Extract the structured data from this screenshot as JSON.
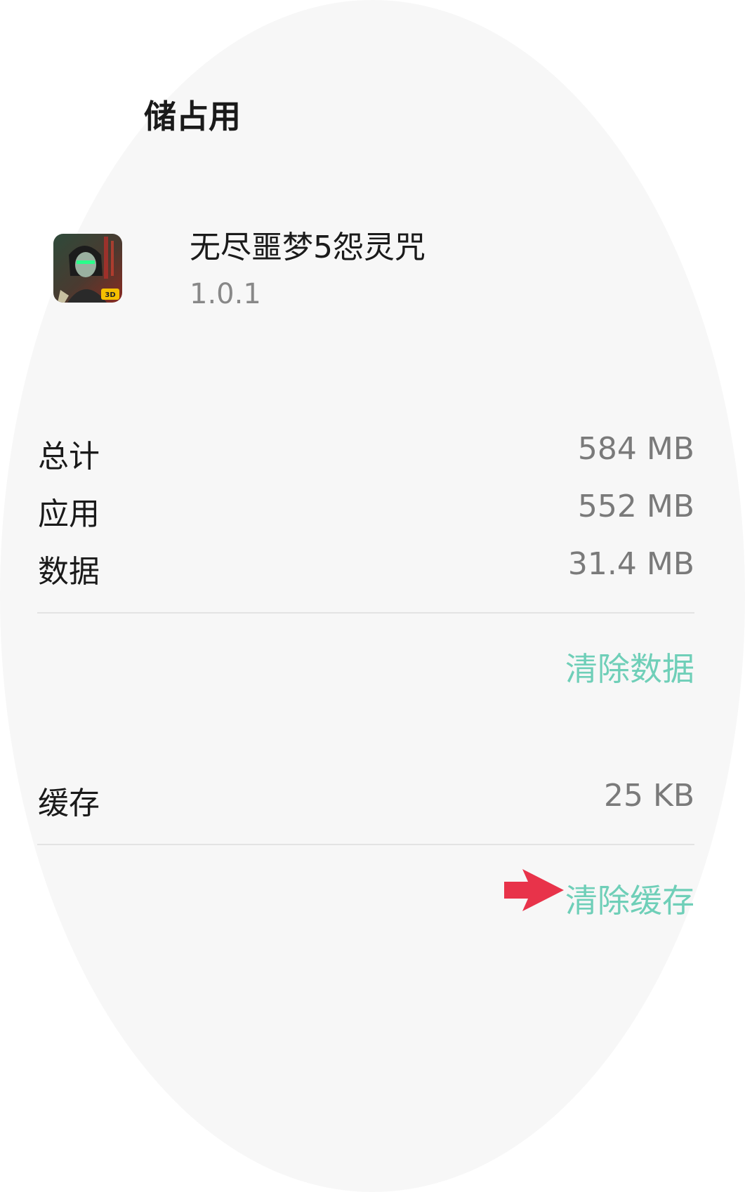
{
  "header": {
    "title": "储占用"
  },
  "app": {
    "name": "无尽噩梦5怨灵咒",
    "version": "1.0.1",
    "icon": "game-character-icon",
    "icon_badge": "3D"
  },
  "storage": {
    "rows": [
      {
        "label": "总计",
        "value": "584 MB"
      },
      {
        "label": "应用",
        "value": "552 MB"
      },
      {
        "label": "数据",
        "value": "31.4 MB"
      }
    ],
    "clear_data_label": "清除数据"
  },
  "cache": {
    "label": "缓存",
    "value": "25 KB",
    "clear_cache_label": "清除缓存"
  },
  "colors": {
    "accent": "#6fcfb8",
    "arrow": "#e8334a",
    "background": "#f7f7f7"
  }
}
